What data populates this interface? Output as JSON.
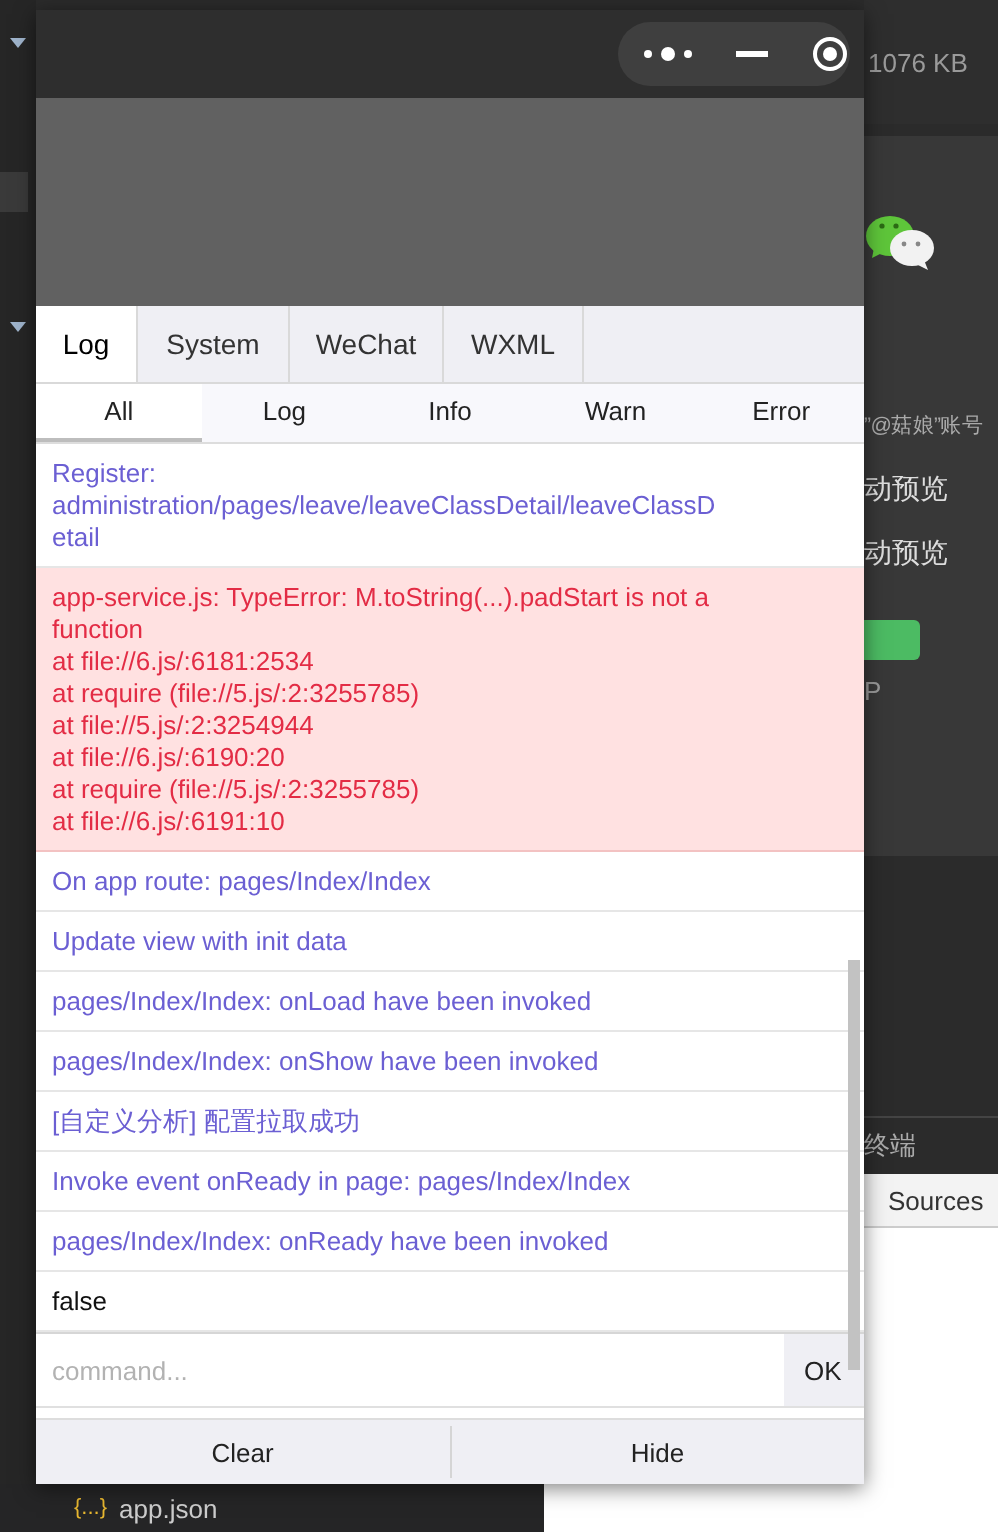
{
  "ide": {
    "size_text": "1076 KB",
    "account_text": "”@菇娘”账号",
    "preview_items": [
      "动预览",
      "动预览"
    ],
    "p_text": "P",
    "terminal_tab": "终端",
    "sources_tab": "Sources",
    "file": {
      "icon": "{...}",
      "name": "app.json"
    }
  },
  "vconsole": {
    "tabs": [
      {
        "label": "Log",
        "selected": true
      },
      {
        "label": "System",
        "selected": false
      },
      {
        "label": "WeChat",
        "selected": false
      },
      {
        "label": "WXML",
        "selected": false
      }
    ],
    "filters": [
      {
        "label": "All",
        "selected": true
      },
      {
        "label": "Log",
        "selected": false
      },
      {
        "label": "Info",
        "selected": false
      },
      {
        "label": "Warn",
        "selected": false
      },
      {
        "label": "Error",
        "selected": false
      }
    ],
    "logs": [
      {
        "kind": "info",
        "text": "Register: administration/pages/leave/leaveClassDetail/leaveClassDetail"
      },
      {
        "kind": "error",
        "text": "app-service.js: TypeError: M.toString(...).padStart is not a function\nat file://6.js/:6181:2534\nat require (file://5.js/:2:3255785)\nat file://5.js/:2:3254944\nat file://6.js/:6190:20\nat require (file://5.js/:2:3255785)\nat file://6.js/:6191:10"
      },
      {
        "kind": "info",
        "text": "On app route: pages/Index/Index"
      },
      {
        "kind": "info",
        "text": "Update view with init data"
      },
      {
        "kind": "info",
        "text": "pages/Index/Index: onLoad have been invoked"
      },
      {
        "kind": "info",
        "text": "pages/Index/Index: onShow have been invoked"
      },
      {
        "kind": "info",
        "text": "[自定义分析] 配置拉取成功"
      },
      {
        "kind": "info",
        "text": "Invoke event onReady in page: pages/Index/Index"
      },
      {
        "kind": "info",
        "text": "pages/Index/Index: onReady have been invoked"
      },
      {
        "kind": "log",
        "text": "false"
      }
    ],
    "command": {
      "placeholder": "command...",
      "button": "OK"
    },
    "footer": [
      "Clear",
      "Hide"
    ]
  }
}
